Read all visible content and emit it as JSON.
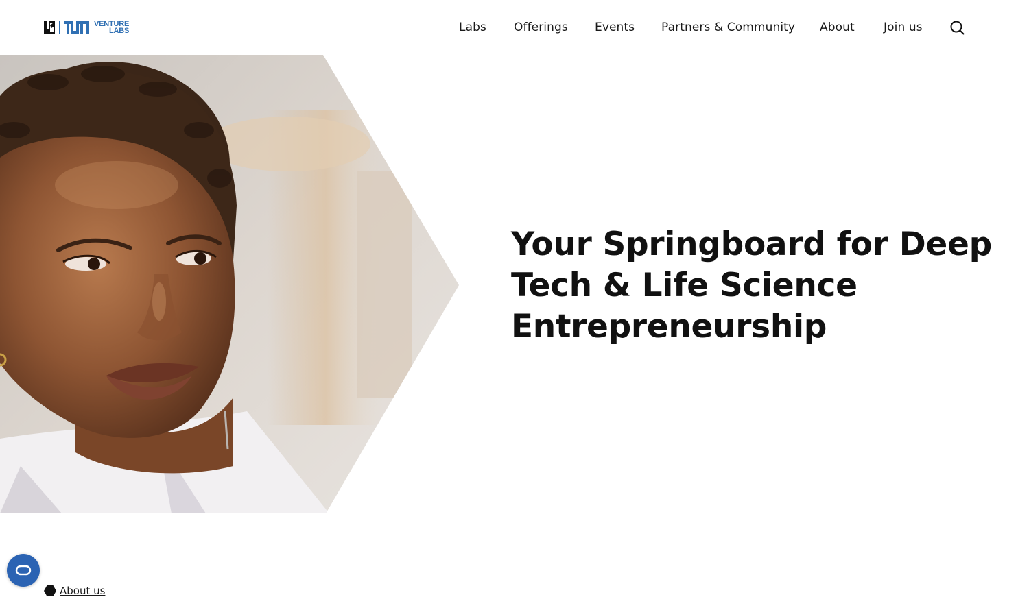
{
  "brand": {
    "logo_line1": "VENTURE",
    "logo_line2": "LABS",
    "logo_alt": "TUM Venture Labs",
    "accent_color": "#3070b3"
  },
  "nav": {
    "items": [
      {
        "label": "Labs"
      },
      {
        "label": "Offerings"
      },
      {
        "label": "Events"
      },
      {
        "label": "Partners & Community"
      },
      {
        "label": "About"
      },
      {
        "label": "Join us"
      }
    ],
    "search_icon": "search-icon"
  },
  "hero": {
    "title": "Your Springboard for Deep Tech & Life Science Entrepreneurship",
    "image_subject": "portrait of a young woman looking to the side"
  },
  "footer_preview": {
    "about_label": "About us"
  },
  "accessibility": {
    "icon": "accessibility-toggle-icon",
    "color": "#2b63b3"
  }
}
